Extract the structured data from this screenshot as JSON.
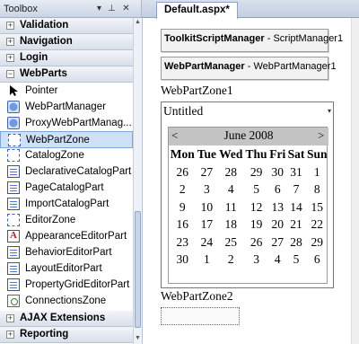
{
  "toolbox": {
    "title": "Toolbox",
    "buttons": {
      "dropdown": "▾",
      "pin": "⊥",
      "close": "✕"
    },
    "categories_top": [
      {
        "label": "Validation",
        "box": "+"
      },
      {
        "label": "Navigation",
        "box": "+"
      },
      {
        "label": "Login",
        "box": "+"
      },
      {
        "label": "WebParts",
        "box": "−"
      }
    ],
    "items": [
      {
        "label": "Pointer",
        "icon": "pointer-icon"
      },
      {
        "label": "WebPartManager",
        "icon": "webpartmanager-icon"
      },
      {
        "label": "ProxyWebPartManag...",
        "icon": "proxywebpartmanager-icon"
      },
      {
        "label": "WebPartZone",
        "icon": "webpartzone-icon"
      },
      {
        "label": "CatalogZone",
        "icon": "catalogzone-icon"
      },
      {
        "label": "DeclarativeCatalogPart",
        "icon": "declarativecatalogpart-icon"
      },
      {
        "label": "PageCatalogPart",
        "icon": "pagecatalogpart-icon"
      },
      {
        "label": "ImportCatalogPart",
        "icon": "importcatalogpart-icon"
      },
      {
        "label": "EditorZone",
        "icon": "editorzone-icon"
      },
      {
        "label": "AppearanceEditorPart",
        "icon": "appearanceeditorpart-icon"
      },
      {
        "label": "BehaviorEditorPart",
        "icon": "behavioreditorpart-icon"
      },
      {
        "label": "LayoutEditorPart",
        "icon": "layouteditorpart-icon"
      },
      {
        "label": "PropertyGridEditorPart",
        "icon": "propertygrideditorpart-icon"
      },
      {
        "label": "ConnectionsZone",
        "icon": "connectionszone-icon"
      }
    ],
    "categories_bottom": [
      {
        "label": "AJAX Extensions",
        "box": "+"
      },
      {
        "label": "Reporting",
        "box": "+"
      }
    ],
    "selected_item": "WebPartZone"
  },
  "designer": {
    "tab": "Default.aspx*",
    "script_manager": {
      "name": "ToolkitScriptManager",
      "sep": " - ",
      "id": "ScriptManager1"
    },
    "webpart_manager": {
      "name": "WebPartManager",
      "sep": " - ",
      "id": "WebPartManager1"
    },
    "zone1_label": "WebPartZone1",
    "part_title": "Untitled",
    "part_menu": "▾",
    "calendar": {
      "prev": "<",
      "next": ">",
      "month": "June 2008",
      "days": [
        "Mon",
        "Tue",
        "Wed",
        "Thu",
        "Fri",
        "Sat",
        "Sun"
      ],
      "weeks": [
        [
          "26",
          "27",
          "28",
          "29",
          "30",
          "31",
          "1"
        ],
        [
          "2",
          "3",
          "4",
          "5",
          "6",
          "7",
          "8"
        ],
        [
          "9",
          "10",
          "11",
          "12",
          "13",
          "14",
          "15"
        ],
        [
          "16",
          "17",
          "18",
          "19",
          "20",
          "21",
          "22"
        ],
        [
          "23",
          "24",
          "25",
          "26",
          "27",
          "28",
          "29"
        ],
        [
          "30",
          "1",
          "2",
          "3",
          "4",
          "5",
          "6"
        ]
      ]
    },
    "zone2_label": "WebPartZone2"
  }
}
